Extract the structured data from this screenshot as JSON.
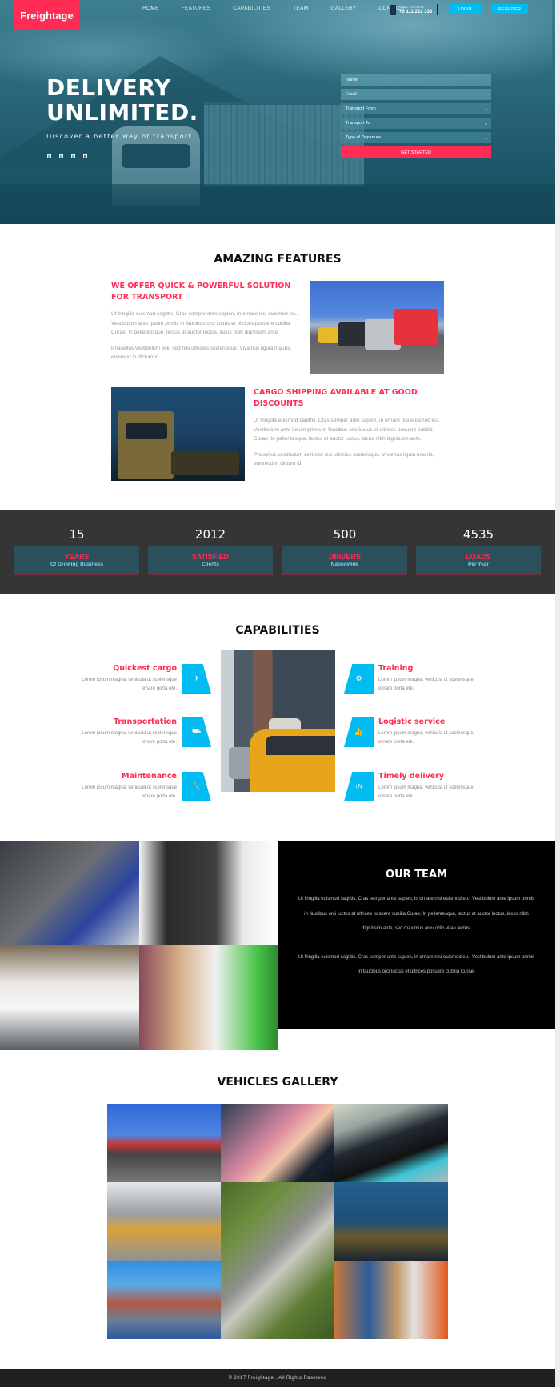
{
  "brand": {
    "name": "Freightage",
    "accent": "#ff2d55",
    "secondary": "#00bcf2"
  },
  "nav": {
    "items": [
      "HOME",
      "FEATURES",
      "CAPABILITIES",
      "TEAM",
      "GALLERY",
      "CONTACT"
    ],
    "call_label": "CALL US NOW",
    "phone": "+0 111 222 333",
    "login": "LOGIN",
    "register": "REGISTER"
  },
  "hero": {
    "title_line1": "DELIVERY",
    "title_line2": "UNLIMITED.",
    "subtitle": "Discover a better way of transport",
    "slides": 4,
    "active_slide": 4,
    "form": {
      "name_placeholder": "Name",
      "email_placeholder": "Email",
      "transport_from": "Transport From",
      "transport_to": "Transport To",
      "departure": "Type of Departure",
      "submit": "GET STARTED"
    }
  },
  "features": {
    "title": "AMAZING FEATURES",
    "items": [
      {
        "heading": "WE OFFER QUICK & POWERFUL SOLUTION FOR TRANSPORT",
        "p1": "Ut fringilla euismod sagittis. Cras semper ante sapien, in ornare nisi euismod eu.. Vestibulum ante ipsum primis in faucibus orci luctus et ultrices posuere cubilia Curae; In pellentesque, lectus at auctor luctus, lacus nibh dignissim ante.",
        "p2": "Phasellus vestibulum velit sed nisi ultricies scelerisque. Vivamus ligula mauris, euismod in dictum id.",
        "image": "parked-trucks-photo"
      },
      {
        "heading": "CARGO SHIPPING AVAILABLE AT GOOD DISCOUNTS",
        "p1": "Ut fringilla euismod sagittis. Cras semper ante sapien, in ornare nisi euismod eu.. Vestibulum ante ipsum primis in faucibus orci luctus et ultrices posuere cubilia Curae; In pellentesque, lectus at auctor luctus, lacus nibh dignissim ante.",
        "p2": "Phasellus vestibulum velit sed nisi ultricies scelerisque. Vivamus ligula mauris, euismod in dictum id.",
        "image": "night-heavy-haul-truck-photo"
      }
    ]
  },
  "stats": [
    {
      "value": "15",
      "label": "YEARS",
      "sub": "Of Growing Business"
    },
    {
      "value": "2012",
      "label": "SATISFIED",
      "sub": "Clients"
    },
    {
      "value": "500",
      "label": "DRIVERS",
      "sub": "Nationwide"
    },
    {
      "value": "4535",
      "label": "LOADS",
      "sub": "Per Year"
    }
  ],
  "capabilities": {
    "title": "CAPABILITIES",
    "left": [
      {
        "title": "Quickest cargo",
        "desc": "Lorem ipsum magna, vehicula ut scelerisque ornare porta ete.",
        "icon": "plane-icon"
      },
      {
        "title": "Transportation",
        "desc": "Lorem ipsum magna, vehicula ut scelerisque ornare porta ete.",
        "icon": "truck-icon"
      },
      {
        "title": "Maintenance",
        "desc": "Lorem ipsum magna, vehicula ut scelerisque ornare porta ete.",
        "icon": "wrench-icon"
      }
    ],
    "right": [
      {
        "title": "Training",
        "desc": "Lorem ipsum magna, vehicula ut scelerisque ornare porta ete.",
        "icon": "gears-icon"
      },
      {
        "title": "Logistic service",
        "desc": "Lorem ipsum magna, vehicula ut scelerisque ornare porta ete.",
        "icon": "thumbs-up-icon"
      },
      {
        "title": "Timely delivery",
        "desc": "Lorem ipsum magna, vehicula ut scelerisque ornare porta ete.",
        "icon": "clock-icon"
      }
    ],
    "icon_glyphs": {
      "plane": "✈",
      "truck": "⛟",
      "wrench": "🔧",
      "gears": "⚙",
      "thumbs": "👍",
      "clock": "◷"
    }
  },
  "team": {
    "title": "OUR TEAM",
    "p1": "Ut fringilla euismod sagittis. Cras semper ante sapien, in ornare nisi euismod eu.. Vestibulum ante ipsum primis in faucibus orci luctus et ultrices posuere cubilia Curae; In pellentesque, lectus at auctor luctus, lacus nibh dignissim ante, sed maximus arcu odio vitae lectus.",
    "p2": "Ut fringilla euismod sagittis. Cras semper ante sapien, in ornare nisi euismod eu.. Vestibulum ante ipsum primis in faucibus orci luctus et ultrices posuere cubilia Curae."
  },
  "gallery": {
    "title": "VEHICLES GALLERY",
    "images": [
      "parked-trucks",
      "driver-steering-wheel",
      "classic-corvette",
      "warehouse-tug",
      "aerial-building",
      "night-truck",
      "harbor-houses",
      "warehouse-forklift"
    ]
  },
  "footer": {
    "text": "© 2017 Freightage . All Rights Reserved"
  }
}
